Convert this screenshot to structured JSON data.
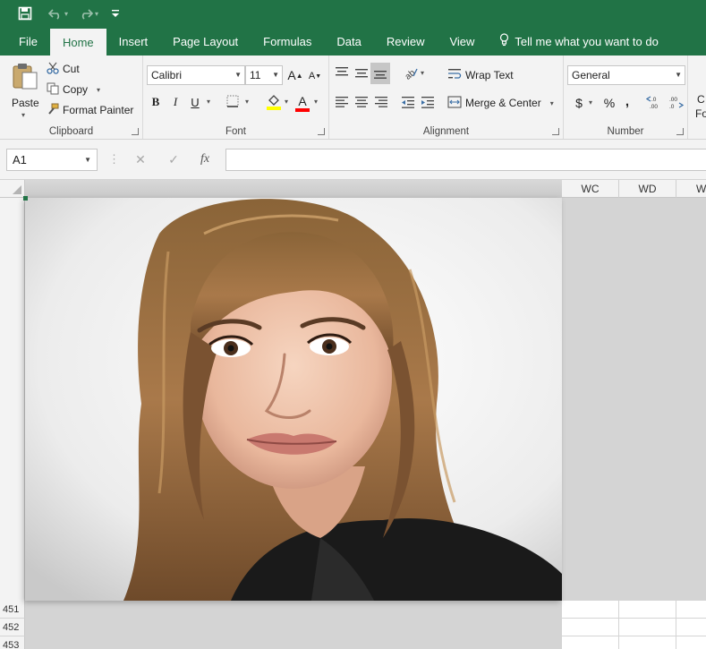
{
  "quick_access": {
    "icons": [
      "save-icon",
      "undo-icon",
      "redo-icon",
      "customize-icon"
    ]
  },
  "tabs": [
    "File",
    "Home",
    "Insert",
    "Page Layout",
    "Formulas",
    "Data",
    "Review",
    "View"
  ],
  "tell_me": "Tell me what you want to do",
  "clipboard": {
    "paste": "Paste",
    "cut": "Cut",
    "copy": "Copy",
    "format_painter": "Format Painter",
    "label": "Clipboard"
  },
  "font": {
    "name": "Calibri",
    "size": "11",
    "grow": "A",
    "shrink": "A",
    "bold": "B",
    "italic": "I",
    "underline": "U",
    "font_color_letter": "A",
    "label": "Font",
    "fill_color": "#ffff00",
    "text_color": "#ff0000"
  },
  "alignment": {
    "wrap_text": "Wrap Text",
    "merge_center": "Merge & Center",
    "label": "Alignment"
  },
  "number": {
    "format": "General",
    "currency": "$",
    "percent": "%",
    "comma": ",",
    "label": "Number"
  },
  "styles": {
    "partial_1": "C",
    "partial_2": "Fo"
  },
  "formula_bar": {
    "name_box": "A1",
    "cancel": "✕",
    "enter": "✓",
    "fx": "fx",
    "value": ""
  },
  "columns": [
    "WC",
    "WD",
    "W"
  ],
  "rows": [
    "451",
    "452",
    "453"
  ],
  "colors": {
    "accent": "#217346",
    "ribbon_bg": "#f3f3f3"
  }
}
